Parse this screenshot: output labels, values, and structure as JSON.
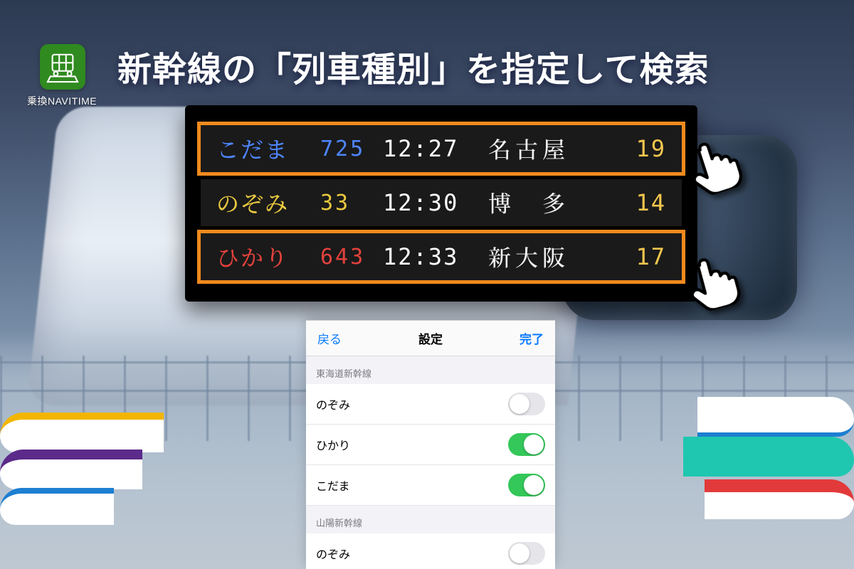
{
  "app": {
    "name": "乗換NAVITIME",
    "icon": "train-app-icon"
  },
  "headline": "新幹線の「列車種別」を指定して検索",
  "board": {
    "rows": [
      {
        "name": "こだま",
        "number": "725",
        "time": "12:27",
        "destination": "名古屋",
        "platform": "19",
        "color": "blue",
        "selected": true
      },
      {
        "name": "のぞみ",
        "number": "33",
        "time": "12:30",
        "destination": "博　多",
        "platform": "14",
        "color": "yellow",
        "selected": false
      },
      {
        "name": "ひかり",
        "number": "643",
        "time": "12:33",
        "destination": "新大阪",
        "platform": "17",
        "color": "red",
        "selected": true
      }
    ]
  },
  "settings_sheet": {
    "back_label": "戻る",
    "title": "設定",
    "done_label": "完了",
    "sections": [
      {
        "header": "東海道新幹線",
        "options": [
          {
            "label": "のぞみ",
            "on": false
          },
          {
            "label": "ひかり",
            "on": true
          },
          {
            "label": "こだま",
            "on": true
          }
        ]
      },
      {
        "header": "山陽新幹線",
        "options": [
          {
            "label": "のぞみ",
            "on": false
          }
        ]
      }
    ]
  },
  "colors": {
    "select_outline": "#f08a1d",
    "toggle_on": "#34c759",
    "ios_blue": "#0a7aff"
  }
}
